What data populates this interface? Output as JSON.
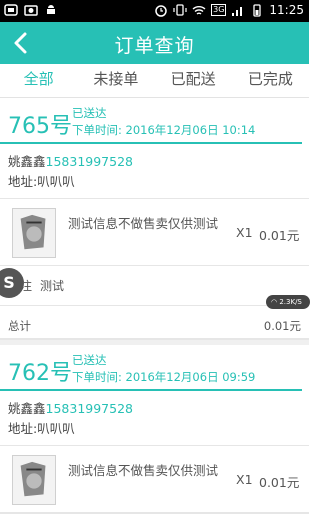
{
  "statusbar": {
    "time": "11:25",
    "network": "3G"
  },
  "header": {
    "title": "订单查询"
  },
  "tabs": [
    {
      "label": "全部"
    },
    {
      "label": "未接单"
    },
    {
      "label": "已配送"
    },
    {
      "label": "已完成"
    }
  ],
  "orders": [
    {
      "number": "765号",
      "status": "已送达",
      "time": "下单时间: 2016年12月06日 10:14",
      "customer_name": "姚鑫鑫",
      "phone": "15831997528",
      "address": "地址:叭叭叭",
      "product_name": "测试信息不做售卖仅供测试",
      "qty": "X1",
      "price": "0.01元",
      "remark_label": "备注",
      "remark_value": "测试",
      "total_label": "总计",
      "total_value": "0.01元"
    },
    {
      "number": "762号",
      "status": "已送达",
      "time": "下单时间: 2016年12月06日 09:59",
      "customer_name": "姚鑫鑫",
      "phone": "15831997528",
      "address": "地址:叭叭叭",
      "product_name": "测试信息不做售卖仅供测试",
      "qty": "X1",
      "price": "0.01元"
    }
  ],
  "speed_indicator": "2.3K/S",
  "float_button": "S"
}
